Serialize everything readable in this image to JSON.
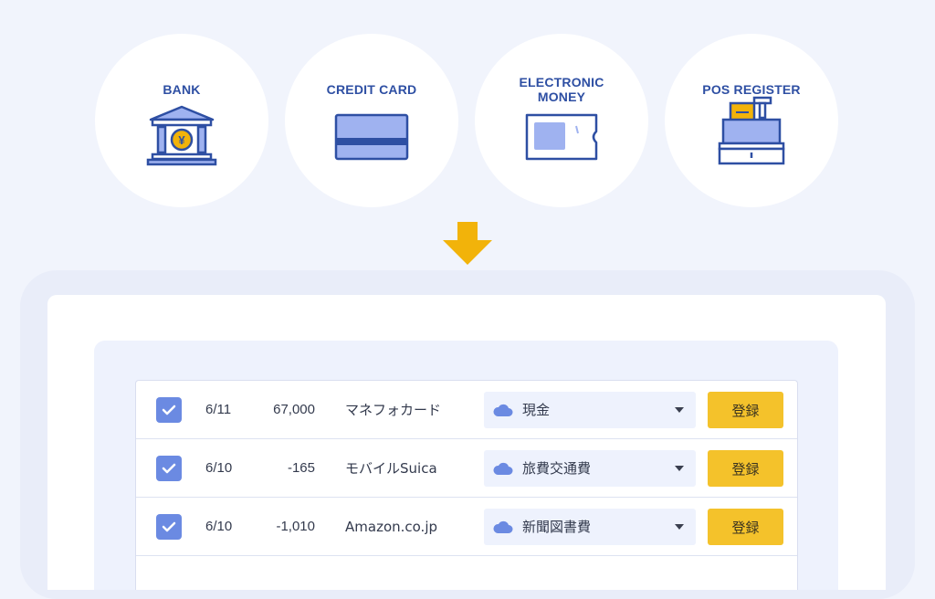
{
  "sources": [
    {
      "label": "BANK",
      "icon": "bank-icon"
    },
    {
      "label": "CREDIT CARD",
      "icon": "credit-card-icon"
    },
    {
      "label": "ELECTRONIC\nMONEY",
      "icon": "electronic-money-icon"
    },
    {
      "label": "POS REGISTER",
      "icon": "pos-register-icon"
    }
  ],
  "arrow_icon": "arrow-down-icon",
  "colors": {
    "background": "#f1f4fc",
    "label": "#2e4fa3",
    "accent_blue": "#6b8ae2",
    "icon_light_blue": "#9fb2f0",
    "button_yellow": "#f4c22b",
    "arrow_yellow": "#f2b30a"
  },
  "transactions": [
    {
      "checked": true,
      "date": "6/11",
      "amount": "67,000",
      "description": "マネフォカード",
      "category": "現金",
      "category_icon": "cloud-icon",
      "button": "登録"
    },
    {
      "checked": true,
      "date": "6/10",
      "amount": "-165",
      "description": "モバイルSuica",
      "category": "旅費交通費",
      "category_icon": "cloud-icon",
      "button": "登録"
    },
    {
      "checked": true,
      "date": "6/10",
      "amount": "-1,010",
      "description": "Amazon.co.jp",
      "category": "新聞図書費",
      "category_icon": "cloud-icon",
      "button": "登録"
    }
  ]
}
